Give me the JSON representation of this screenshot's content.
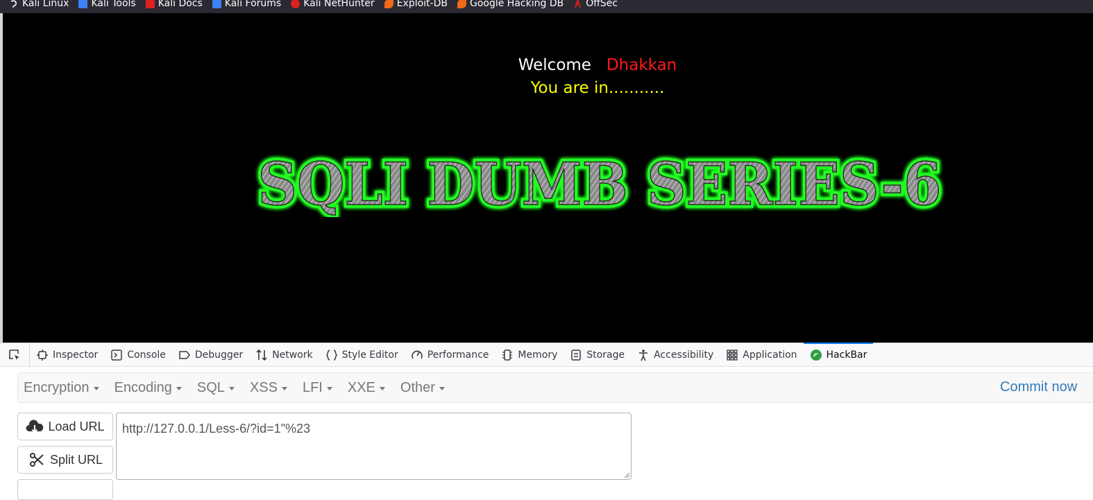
{
  "bookmarks": [
    {
      "label": "Kali Linux",
      "icon": "kali-dragon-icon",
      "color": "#fbfbfe"
    },
    {
      "label": "Kali Tools",
      "icon": "kali-tools-icon",
      "color": "#3b82f6"
    },
    {
      "label": "Kali Docs",
      "icon": "kali-docs-icon",
      "color": "#e02020"
    },
    {
      "label": "Kali Forums",
      "icon": "kali-forums-icon",
      "color": "#3b82f6"
    },
    {
      "label": "Kali NetHunter",
      "icon": "nethunter-icon",
      "color": "#e02020"
    },
    {
      "label": "Exploit-DB",
      "icon": "exploit-db-icon",
      "color": "#f06a1a"
    },
    {
      "label": "Google Hacking DB",
      "icon": "ghdb-icon",
      "color": "#f06a1a"
    },
    {
      "label": "OffSec",
      "icon": "offsec-icon",
      "color": "#e02020"
    }
  ],
  "page": {
    "welcome_label": "Welcome",
    "user_name": "Dhakkan",
    "status": "You are in...........",
    "banner_title": "SQLI DUMB SERIES-6",
    "colors": {
      "background": "#000000",
      "welcome": "#ffffff",
      "name": "#ff1a1a",
      "status": "#ffff00",
      "banner_glow": "#22ff22"
    }
  },
  "devtools": {
    "tabs": [
      {
        "label": "Inspector",
        "icon": "inspector-icon"
      },
      {
        "label": "Console",
        "icon": "console-icon"
      },
      {
        "label": "Debugger",
        "icon": "debugger-icon"
      },
      {
        "label": "Network",
        "icon": "network-icon"
      },
      {
        "label": "Style Editor",
        "icon": "style-editor-icon"
      },
      {
        "label": "Performance",
        "icon": "performance-icon"
      },
      {
        "label": "Memory",
        "icon": "memory-icon"
      },
      {
        "label": "Storage",
        "icon": "storage-icon"
      },
      {
        "label": "Accessibility",
        "icon": "accessibility-icon"
      },
      {
        "label": "Application",
        "icon": "application-icon"
      },
      {
        "label": "HackBar",
        "icon": "hackbar-icon",
        "active": true
      }
    ]
  },
  "hackbar": {
    "menu": [
      "Encryption",
      "Encoding",
      "SQL",
      "XSS",
      "LFI",
      "XXE",
      "Other"
    ],
    "commit_label": "Commit now",
    "load_url_label": "Load URL",
    "split_url_label": "Split URL",
    "url_value": "http://127.0.0.1/Less-6/?id=1\"%23"
  }
}
